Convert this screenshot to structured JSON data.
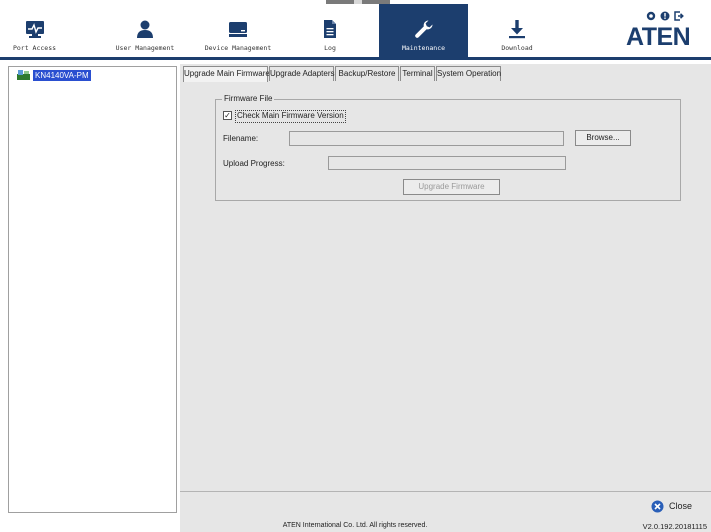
{
  "nav": {
    "items": [
      {
        "label": "Port Access",
        "icon": "monitor-icon"
      },
      {
        "label": "User Management",
        "icon": "user-icon"
      },
      {
        "label": "Device Management",
        "icon": "device-icon"
      },
      {
        "label": "Log",
        "icon": "document-icon"
      },
      {
        "label": "Maintenance",
        "icon": "wrench-icon",
        "active": true
      },
      {
        "label": "Download",
        "icon": "download-icon"
      }
    ],
    "top_icons": [
      "settings-icon",
      "help-icon",
      "logout-icon"
    ],
    "logo": "ATEN",
    "active_color": "#1c3e6e"
  },
  "tree": {
    "node_label": "KN4140VA-PM",
    "selected_color": "#2a4fd0"
  },
  "tabs": [
    {
      "label": "Upgrade Main Firmware",
      "active": true
    },
    {
      "label": "Upgrade Adapters"
    },
    {
      "label": "Backup/Restore"
    },
    {
      "label": "Terminal"
    },
    {
      "label": "System Operation"
    }
  ],
  "firmware": {
    "group_label": "Firmware File",
    "check_label": "Check Main Firmware Version",
    "checked": true,
    "check_mark": "✓",
    "filename_label": "Filename:",
    "filename_value": "",
    "browse_label": "Browse...",
    "progress_label": "Upload Progress:",
    "progress": 0,
    "upgrade_label": "Upgrade Firmware"
  },
  "close_label": "Close",
  "footer": {
    "copyright": "ATEN International Co. Ltd. All rights reserved.",
    "version": "V2.0.192.20181115"
  }
}
